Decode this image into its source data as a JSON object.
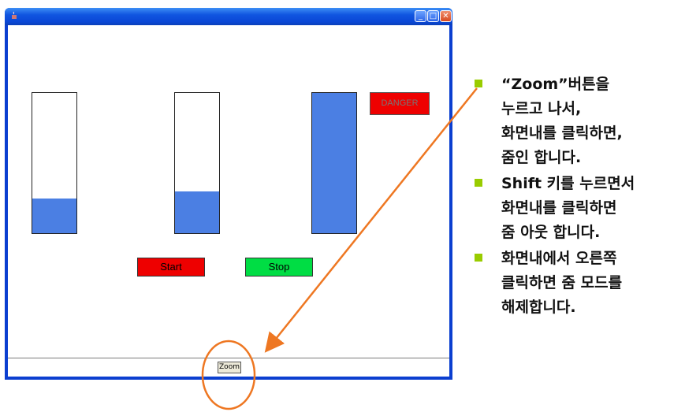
{
  "window": {
    "controls": {
      "minimize_icon": "minimize-icon",
      "maximize_icon": "maximize-icon",
      "close_icon": "close-icon"
    }
  },
  "gauges": [
    {
      "name": "gauge-1",
      "level": 0.25
    },
    {
      "name": "gauge-2",
      "level": 0.3
    },
    {
      "name": "gauge-3",
      "level": 1.0
    }
  ],
  "danger_label": "DANGER",
  "buttons": {
    "start": "Start",
    "stop": "Stop",
    "zoom": "Zoom"
  },
  "colors": {
    "gauge_fill": "#4b7fe3",
    "start_bg": "#ee0000",
    "stop_bg": "#00dd44",
    "danger_bg": "#ee0000",
    "bullet": "#99cc00",
    "annotation": "#ee7722"
  },
  "notes": [
    {
      "lines": [
        "“Zoom”버튼을",
        "누르고 나서,",
        "화면내를 클릭하면,",
        "줌인 합니다."
      ]
    },
    {
      "lines": [
        "Shift 키를 누르면서",
        "화면내를 클릭하면",
        "줌 아웃 합니다."
      ]
    },
    {
      "lines": [
        "화면내에서 오른쪽",
        "클릭하면 줌 모드를",
        "해제합니다."
      ]
    }
  ]
}
